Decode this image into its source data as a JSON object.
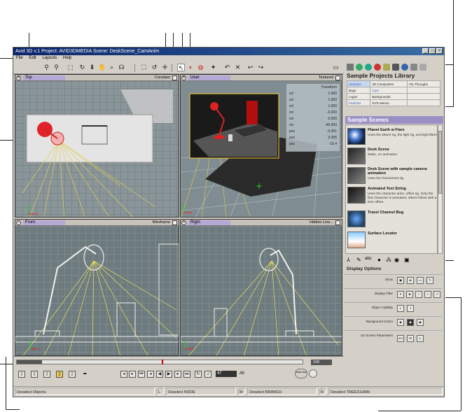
{
  "app": {
    "title": "Avid 3D v.1 Project: AVID3DMEDIA    Scene: DeskScene_CamAnim",
    "window_controls": [
      "_",
      "□",
      "×"
    ]
  },
  "menubar": [
    "File",
    "Edit",
    "Layouts",
    "Help"
  ],
  "toolbar": {
    "icons": [
      "binoculars-icon",
      "binoculars-orbit-icon",
      "select-icon",
      "refresh-icon",
      "down-arrow-icon",
      "hand-icon",
      "zoom-icon",
      "headphones-icon",
      "frame-all-icon",
      "rotate-icon",
      "translate-icon",
      "select-tool-icon",
      "paint-icon",
      "scale-icon",
      "star-icon",
      "undo-curve-icon",
      "delete-icon",
      "undo-icon",
      "redo-icon",
      "layout-icon"
    ]
  },
  "viewports": {
    "top": {
      "num": "A",
      "name": "Top",
      "mode": "Constant"
    },
    "user": {
      "num": "B",
      "name": "User",
      "mode": "Textured"
    },
    "front": {
      "num": "C",
      "name": "Front",
      "mode": "Wireframe"
    },
    "right": {
      "num": "D",
      "name": "Right",
      "mode": "Hidden Line..."
    }
  },
  "transform_panel": {
    "title": "Transform",
    "rows": [
      {
        "label": "scl",
        "value": "1.000"
      },
      {
        "label": "scl",
        "value": "1.000"
      },
      {
        "label": "scl",
        "value": "1.000"
      },
      {
        "label": "rot",
        "value": "-0.000"
      },
      {
        "label": "rot",
        "value": "0.000"
      },
      {
        "label": "rot",
        "value": "-45.000"
      },
      {
        "label": "pos",
        "value": "-0.951"
      },
      {
        "label": "pos",
        "value": "9.305"
      },
      {
        "label": "pos",
        "value": "-16.4"
      }
    ]
  },
  "right_panel": {
    "library_title": "Sample Projects Library",
    "library_rows": [
      [
        "Samples",
        "3D Composites",
        "Fly-Throughs"
      ],
      [
        "Bugs",
        "Cars",
        ""
      ],
      [
        "Logos",
        "Backgrounds",
        ""
      ],
      [
        "Particles",
        "DVD Menus",
        ""
      ]
    ],
    "scenes_title": "Sample Scenes",
    "scenes": [
      {
        "name": "Planet Earth w Flare",
        "desc": "Uses the planet rig, the light rig, and light flares"
      },
      {
        "name": "Desk Scene",
        "desc": "Static, no animation"
      },
      {
        "name": "Desk Scene with sample camera animation",
        "desc": "Uses the freecamera rig"
      },
      {
        "name": "Animated Text String",
        "desc": "Uses the character anim. offset rig. Only the first character is animated, others follow with a time offset."
      },
      {
        "name": "Travel Channel Bug",
        "desc": ""
      },
      {
        "name": "Surface Locator",
        "desc": ""
      }
    ],
    "display_title": "Display Options",
    "display_rows": [
      {
        "label": "Show",
        "buttons": [
          "▣",
          "◈",
          "▭",
          "✎"
        ]
      },
      {
        "label": "Display Filter",
        "buttons": [
          "✦",
          "■",
          "/",
          "✧",
          "↗"
        ]
      },
      {
        "label": "Object Visibility",
        "buttons": [
          "◐",
          "◑"
        ]
      },
      {
        "label": "Background Colors",
        "buttons": [
          "◆",
          "◆",
          "◆"
        ]
      },
      {
        "label": "On Screen Parameters",
        "buttons": [
          "sm",
          "M",
          "L"
        ]
      }
    ]
  },
  "timeline": {
    "start": "1",
    "end": "100",
    "current": "47",
    "all_label": "All",
    "autokey_label": "auto key"
  },
  "statusbar": {
    "left": "Deselect Objects",
    "l": "L",
    "mid1": "Deselect NODE",
    "m": "M",
    "mid2": "Deselect BRANCH",
    "r": "R",
    "right": "Deselect TREE/CHAIN"
  },
  "colors": {
    "viewport_bg": "#6f7d83",
    "title_gradient_start": "#0a246a",
    "lamp_red": "#e2222a",
    "scenes_header": "#9a8fc4"
  }
}
